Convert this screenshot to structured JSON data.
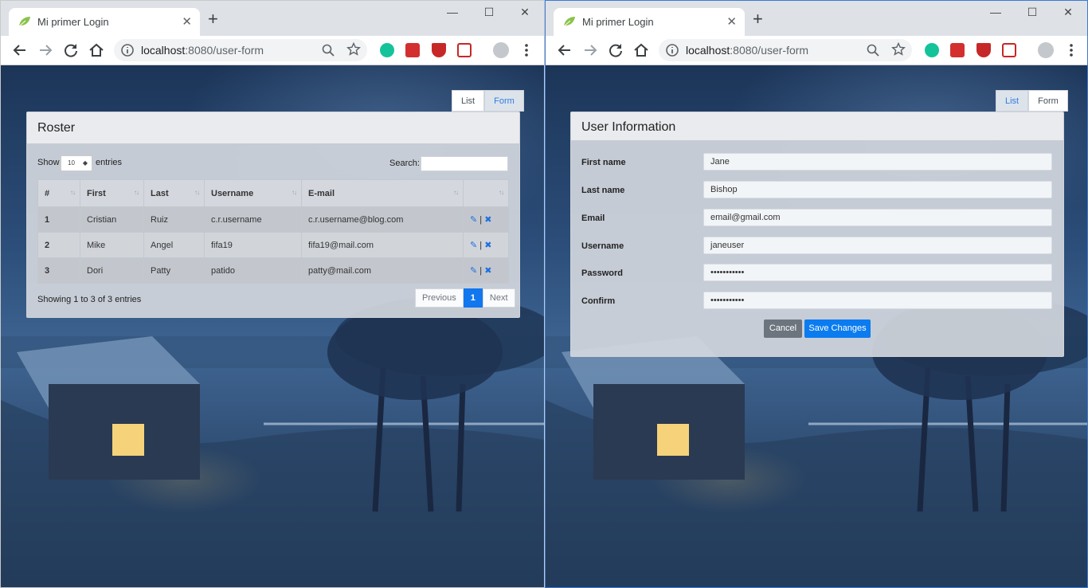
{
  "windows": [
    {
      "tab_title": "Mi primer Login",
      "url_host": "localhost",
      "url_rest": ":8080/user-form",
      "panel_tabs": [
        "List",
        "Form"
      ],
      "active_tab": "List"
    },
    {
      "tab_title": "Mi primer Login",
      "url_host": "localhost",
      "url_rest": ":8080/user-form",
      "panel_tabs": [
        "List",
        "Form"
      ],
      "active_tab": "Form"
    }
  ],
  "roster": {
    "title": "Roster",
    "show_label": "Show",
    "entries_label": "entries",
    "length_value": "10",
    "search_label": "Search:",
    "columns": [
      "#",
      "First",
      "Last",
      "Username",
      "E-mail"
    ],
    "rows": [
      {
        "id": "1",
        "first": "Cristian",
        "last": "Ruiz",
        "username": "c.r.username",
        "email": "c.r.username@blog.com"
      },
      {
        "id": "2",
        "first": "Mike",
        "last": "Angel",
        "username": "fifa19",
        "email": "fifa19@mail.com"
      },
      {
        "id": "3",
        "first": "Dori",
        "last": "Patty",
        "username": "patido",
        "email": "patty@mail.com"
      }
    ],
    "info": "Showing 1 to 3 of 3 entries",
    "pager": {
      "previous": "Previous",
      "current": "1",
      "next": "Next"
    }
  },
  "form": {
    "title": "User Information",
    "fields": [
      {
        "label": "First name",
        "value": "Jane"
      },
      {
        "label": "Last name",
        "value": "Bishop"
      },
      {
        "label": "Email",
        "value": "email@gmail.com"
      },
      {
        "label": "Username",
        "value": "janeuser"
      },
      {
        "label": "Password",
        "value": "•••••••••••"
      },
      {
        "label": "Confirm",
        "value": "•••••••••••"
      }
    ],
    "cancel": "Cancel",
    "save": "Save Changes"
  },
  "icons": {
    "favicon": "leaf-icon",
    "edit": "edit-icon",
    "delete_user": "user-delete-icon",
    "separator": "|"
  },
  "colors": {
    "accent": "#1177ee",
    "secondary_button": "#6c757d",
    "tab_active_text": "#2f7de1"
  }
}
